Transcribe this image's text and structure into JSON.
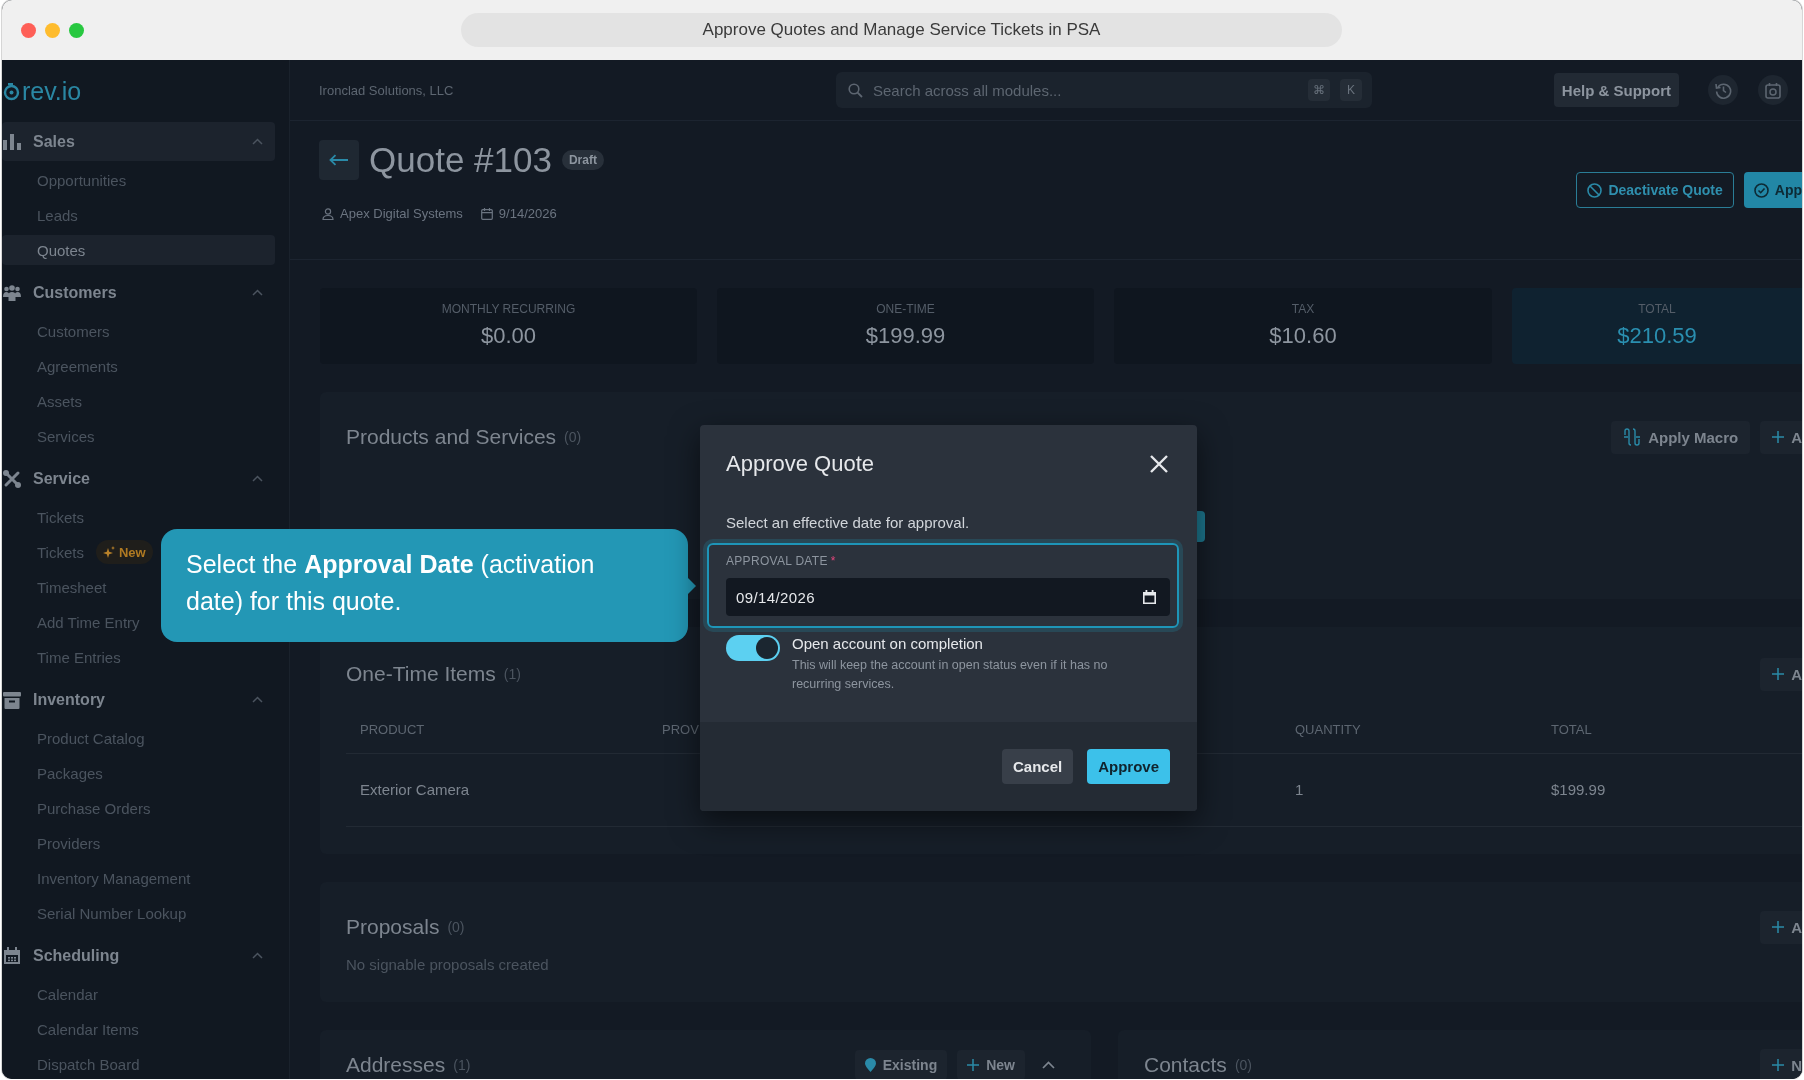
{
  "window": {
    "title": "Approve Quotes and Manage Service Tickets in PSA"
  },
  "sidebar": {
    "logo": "rev.io",
    "groups": [
      {
        "label": "Sales",
        "selected": true,
        "expanded": true,
        "items": [
          {
            "label": "Opportunities",
            "selected": false
          },
          {
            "label": "Leads",
            "selected": false
          },
          {
            "label": "Quotes",
            "selected": true
          }
        ]
      },
      {
        "label": "Customers",
        "selected": false,
        "expanded": true,
        "items": [
          {
            "label": "Customers",
            "selected": false
          },
          {
            "label": "Agreements",
            "selected": false
          },
          {
            "label": "Assets",
            "selected": false
          },
          {
            "label": "Services",
            "selected": false
          }
        ]
      },
      {
        "label": "Service",
        "selected": false,
        "expanded": true,
        "items": [
          {
            "label": "Tickets",
            "selected": false
          },
          {
            "label": "Tickets",
            "selected": false,
            "badge": "New"
          },
          {
            "label": "Timesheet",
            "selected": false
          },
          {
            "label": "Add Time Entry",
            "selected": false
          },
          {
            "label": "Time Entries",
            "selected": false
          }
        ]
      },
      {
        "label": "Inventory",
        "selected": false,
        "expanded": true,
        "items": [
          {
            "label": "Product Catalog",
            "selected": false
          },
          {
            "label": "Packages",
            "selected": false
          },
          {
            "label": "Purchase Orders",
            "selected": false
          },
          {
            "label": "Providers",
            "selected": false
          },
          {
            "label": "Inventory Management",
            "selected": false
          },
          {
            "label": "Serial Number Lookup",
            "selected": false
          }
        ]
      },
      {
        "label": "Scheduling",
        "selected": false,
        "expanded": true,
        "items": [
          {
            "label": "Calendar",
            "selected": false
          },
          {
            "label": "Calendar Items",
            "selected": false
          },
          {
            "label": "Dispatch Board",
            "selected": false
          }
        ]
      }
    ]
  },
  "topbar": {
    "organization": "Ironclad Solutions, LLC",
    "search": {
      "placeholder": "Search across all modules...",
      "shortcut": [
        "⌘",
        "K"
      ]
    },
    "help_button": "Help & Support"
  },
  "quote": {
    "title": "Quote #103",
    "status": "Draft",
    "customer": "Apex Digital Systems",
    "date": "9/14/2026",
    "actions": [
      {
        "label": "Deactivate Quote",
        "kind": "outline"
      },
      {
        "label": "App",
        "kind": "filled"
      }
    ]
  },
  "summary": [
    {
      "label": "MONTHLY RECURRING",
      "value": "$0.00",
      "highlight": false
    },
    {
      "label": "ONE-TIME",
      "value": "$199.99",
      "highlight": false
    },
    {
      "label": "TAX",
      "value": "$10.60",
      "highlight": false
    },
    {
      "label": "TOTAL",
      "value": "$210.59",
      "highlight": true
    }
  ],
  "products": {
    "title": "Products and Services",
    "count": "(0)",
    "buttons": [
      {
        "label": "Apply Macro",
        "kind": "macro"
      },
      {
        "label": "A",
        "kind": "add"
      }
    ]
  },
  "one_time_items": {
    "title": "One-Time Items",
    "count": "(1)",
    "buttons": [
      {
        "label": "A",
        "kind": "add"
      }
    ],
    "columns": [
      "PRODUCT",
      "PROV",
      "QUANTITY",
      "TOTAL"
    ],
    "rows": [
      {
        "product": "Exterior Camera",
        "quantity": "1",
        "total": "$199.99"
      }
    ]
  },
  "proposals": {
    "title": "Proposals",
    "count": "(0)",
    "buttons": [
      {
        "label": "A",
        "kind": "add"
      }
    ],
    "empty_text": "No signable proposals created"
  },
  "addresses": {
    "title": "Addresses",
    "count": "(1)",
    "expanded": true,
    "buttons": [
      {
        "label": "Existing",
        "kind": "existing"
      },
      {
        "label": "New",
        "kind": "add"
      }
    ]
  },
  "contacts": {
    "title": "Contacts",
    "count": "(0)",
    "buttons": [
      {
        "label": "N",
        "kind": "add"
      }
    ]
  },
  "modal": {
    "title": "Approve Quote",
    "prompt": "Select an effective date for approval.",
    "field": {
      "label": "APPROVAL DATE",
      "required_mark": "*",
      "value": "09/14/2026"
    },
    "toggle": {
      "label": "Open account on completion",
      "description": "This will keep the account in open status even if it has no recurring services.",
      "on": true
    },
    "buttons": [
      {
        "label": "Cancel",
        "kind": "cancel"
      },
      {
        "label": "Approve",
        "kind": "confirm"
      }
    ]
  },
  "tooltip": {
    "text": "Select the **Approval Date** (activation date) for this quote."
  }
}
